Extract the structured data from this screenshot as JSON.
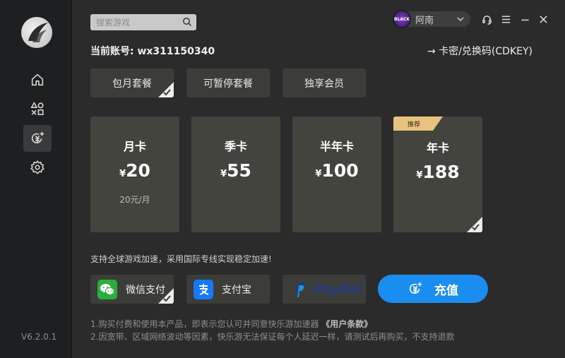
{
  "app": {
    "version": "V6.2.0.1"
  },
  "sidebar": {
    "items": [
      {
        "name": "home",
        "icon": "home-icon"
      },
      {
        "name": "games",
        "icon": "shapes-icon"
      },
      {
        "name": "recharge",
        "icon": "recharge-icon",
        "active": true
      },
      {
        "name": "settings",
        "icon": "gear-icon"
      }
    ]
  },
  "search": {
    "placeholder": "搜索游戏"
  },
  "user": {
    "name": "阿南",
    "avatar_text": "BLACK"
  },
  "account": {
    "label": "当前账号: wx311150340",
    "cdkey_label": "→ 卡密/兑换码(CDKEY)"
  },
  "tabs": [
    {
      "label": "包月套餐",
      "selected": true
    },
    {
      "label": "可暂停套餐",
      "selected": false
    },
    {
      "label": "独享会员",
      "selected": false
    }
  ],
  "plans": [
    {
      "name": "月卡",
      "currency": "¥",
      "price": "20",
      "sub": "20元/月",
      "badge": "",
      "selected": false
    },
    {
      "name": "季卡",
      "currency": "¥",
      "price": "55",
      "sub": "",
      "badge": "",
      "selected": false
    },
    {
      "name": "半年卡",
      "currency": "¥",
      "price": "100",
      "sub": "",
      "badge": "",
      "selected": false
    },
    {
      "name": "年卡",
      "currency": "¥",
      "price": "188",
      "sub": "",
      "badge": "推荐",
      "selected": true
    }
  ],
  "support_text": "支持全球游戏加速，采用国际专线实现稳定加速!",
  "payments": [
    {
      "label": "微信支付",
      "icon": "wechat-icon",
      "color": "#2aae3a",
      "selected": true
    },
    {
      "label": "支付宝",
      "icon": "alipay-icon",
      "color": "#1677ff",
      "selected": false
    },
    {
      "label": "PayPal",
      "icon": "paypal-icon",
      "color": "#253b80",
      "selected": false
    }
  ],
  "recharge_button": {
    "label": "充值"
  },
  "notes": {
    "line1_prefix": "1.购买付费和使用本产品，即表示您认可并同意快乐游加速器",
    "line1_link": "《用户条款》",
    "line2": "2.因宽带、区域网络波动等因素，快乐游无法保证每个人延迟一样，请测试后再购买，不支持退款"
  },
  "colors": {
    "accent": "#1a8df0",
    "badge": "#e8c27e",
    "card": "#43443e"
  }
}
